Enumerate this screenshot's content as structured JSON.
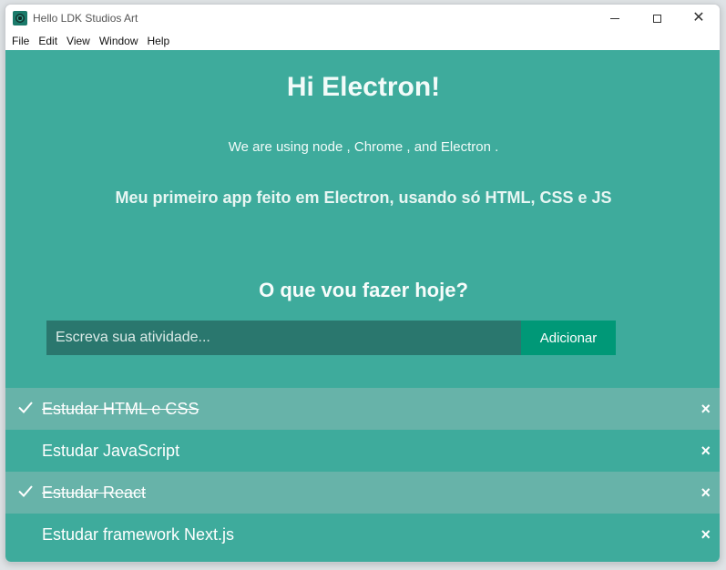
{
  "window": {
    "title": "Hello LDK Studios Art",
    "controls": {
      "minimize": "",
      "maximize": "",
      "close": "✕"
    }
  },
  "menu": {
    "items": [
      "File",
      "Edit",
      "View",
      "Window",
      "Help"
    ]
  },
  "main": {
    "heading": "Hi Electron!",
    "tech_line": "We are using node , Chrome , and Electron .",
    "subtitle": "Meu primeiro app feito em Electron, usando só HTML, CSS e JS",
    "question": "O que vou fazer hoje?",
    "input": {
      "placeholder": "Escreva sua atividade...",
      "value": ""
    },
    "add_label": "Adicionar"
  },
  "todos": [
    {
      "text": "Estudar HTML e CSS",
      "done": true
    },
    {
      "text": "Estudar JavaScript",
      "done": false
    },
    {
      "text": "Estudar React",
      "done": true
    },
    {
      "text": "Estudar framework Next.js",
      "done": false
    }
  ],
  "icons": {
    "check": "check-icon",
    "delete": "close-icon",
    "delete_glyph": "×"
  },
  "colors": {
    "background": "#3eab9c",
    "done_row": "#67b3a9",
    "input_bg": "#2a776e",
    "button_bg": "#009877"
  }
}
